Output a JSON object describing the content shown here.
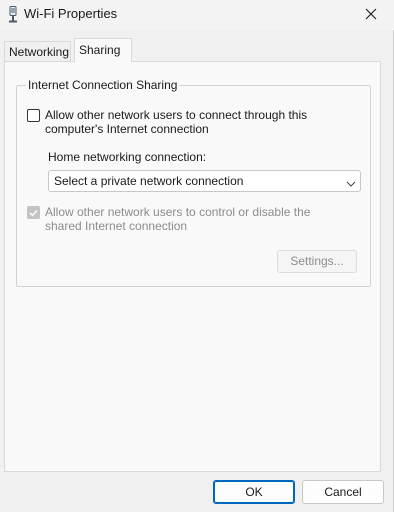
{
  "window": {
    "title": "Wi-Fi Properties",
    "title_icon": "wifi-adapter-icon",
    "close_icon": "close-icon"
  },
  "tabs": [
    {
      "label": "Networking",
      "selected": false
    },
    {
      "label": "Sharing",
      "selected": true
    }
  ],
  "ics": {
    "legend": "Internet Connection Sharing",
    "allow_connect": {
      "label": "Allow other network users to connect through this computer's Internet connection",
      "checked": false,
      "enabled": true
    },
    "home_label": "Home networking connection:",
    "home_select": {
      "value": "Select a private network connection",
      "chevron_icon": "chevron-down-icon"
    },
    "allow_control": {
      "label": "Allow other network users to control or disable the shared Internet connection",
      "checked": true,
      "enabled": false
    },
    "settings_label": "Settings..."
  },
  "footer": {
    "ok_label": "OK",
    "cancel_label": "Cancel"
  },
  "colors": {
    "accent": "#0067c0",
    "disabled_text": "#8c8c8c"
  }
}
